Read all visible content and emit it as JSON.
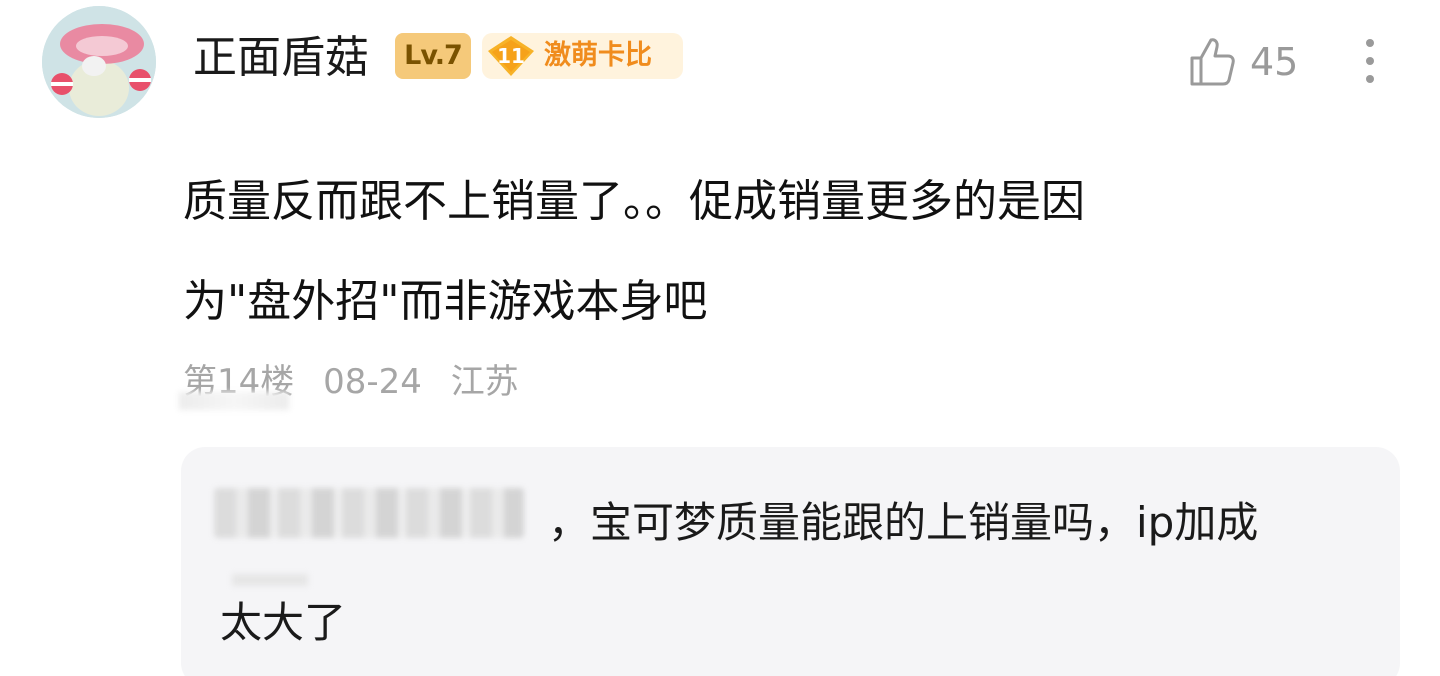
{
  "comment": {
    "username": "正面盾菇",
    "level_badge": "Lv.7",
    "fan_badge": {
      "level": "11",
      "label": "激萌卡比"
    },
    "like_count": "45",
    "body_lines": [
      "质量反而跟不上销量了。。促成销量更多的是因",
      "为\"盘外招\"而非游戏本身吧"
    ],
    "meta": {
      "floor": "第14楼",
      "date": "08-24",
      "location": "江苏"
    }
  },
  "reply": {
    "separator": "，",
    "text_line1": "宝可梦质量能跟的上销量吗，ip加成",
    "text_line2": "太大了"
  },
  "icons": {
    "like": "thumbs-up-icon",
    "more": "more-vertical-icon",
    "fan": "diamond-badge-icon"
  },
  "colors": {
    "level_badge": "#f5c97a",
    "fan_label": "#f08c1d",
    "muted": "#a6a6a6",
    "reply_bg": "#f5f5f7"
  }
}
